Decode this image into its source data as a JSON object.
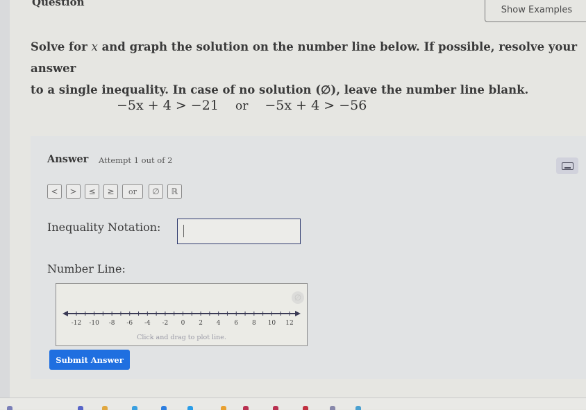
{
  "header": {
    "question_label": "Question",
    "show_examples_label": "Show Examples"
  },
  "question": {
    "line1_a": "Solve for ",
    "line1_var": "x",
    "line1_b": " and graph the solution on the number line below. If possible, resolve your answer",
    "line2": "to a single inequality. In case of no solution (∅), leave the number line blank.",
    "equation_left": "−5x + 4 > −21",
    "equation_joiner": "or",
    "equation_right": "−5x + 4 > −56"
  },
  "answer": {
    "title": "Answer",
    "attempt": "Attempt 1 out of 2",
    "keyboard_icon": "keyboard-icon",
    "symbols": [
      "<",
      ">",
      "≤",
      "≥",
      "or",
      "∅",
      "ℝ"
    ],
    "inequality_label": "Inequality Notation:",
    "inequality_value": "",
    "number_line_label": "Number Line:",
    "number_line_hint": "Click and drag to plot line.",
    "number_line": {
      "min": -13,
      "max": 13,
      "tick_step": 1,
      "label_values": [
        -12,
        -10,
        -8,
        -6,
        -4,
        -2,
        0,
        2,
        4,
        6,
        8,
        10,
        12
      ],
      "labels": [
        "-12",
        "-10",
        "-8",
        "-6",
        "-4",
        "-2",
        "0",
        "2",
        "4",
        "6",
        "8",
        "10",
        "12"
      ],
      "clear_icon": "empty-set-icon"
    },
    "submit_label": "Submit Answer"
  },
  "colors": {
    "submit_bg": "#1f6fe0",
    "input_border": "#2e3a6e",
    "axis": "#3a3a55"
  }
}
